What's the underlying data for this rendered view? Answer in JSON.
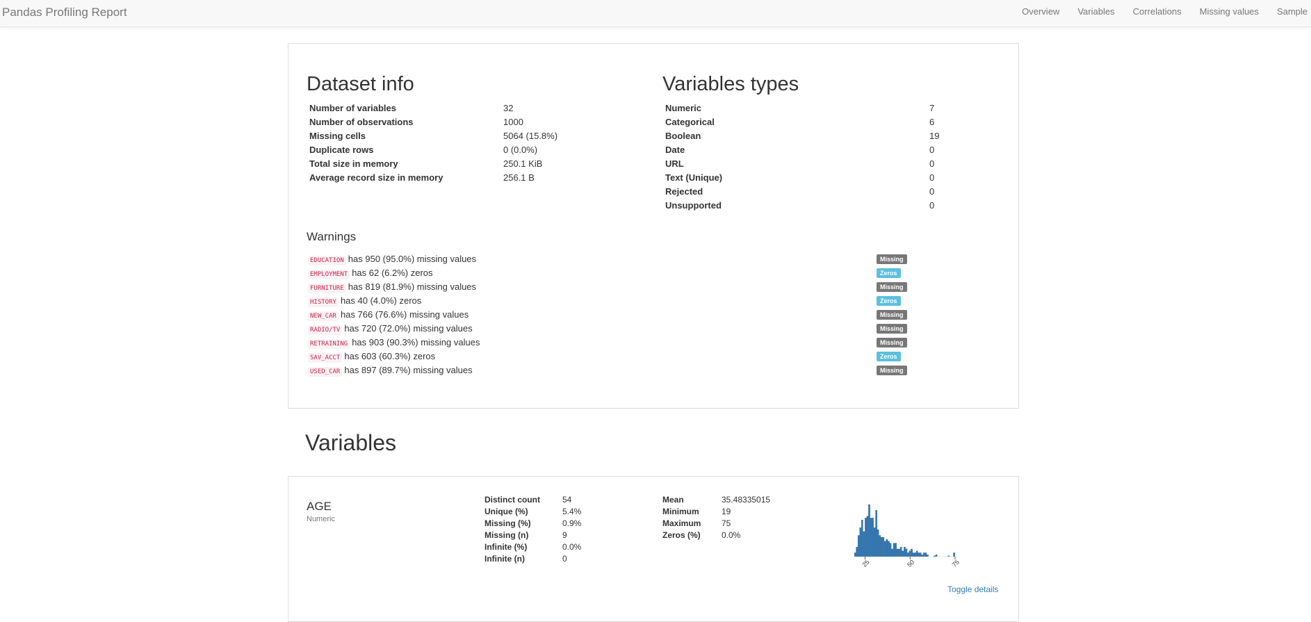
{
  "navbar": {
    "brand": "Pandas Profiling Report",
    "links": [
      "Overview",
      "Variables",
      "Correlations",
      "Missing values",
      "Sample"
    ]
  },
  "dataset_info": {
    "title": "Dataset info",
    "rows": [
      {
        "label": "Number of variables",
        "value": "32"
      },
      {
        "label": "Number of observations",
        "value": "1000"
      },
      {
        "label": "Missing cells",
        "value": "5064 (15.8%)"
      },
      {
        "label": "Duplicate rows",
        "value": "0 (0.0%)"
      },
      {
        "label": "Total size in memory",
        "value": "250.1 KiB"
      },
      {
        "label": "Average record size in memory",
        "value": "256.1 B"
      }
    ]
  },
  "variable_types": {
    "title": "Variables types",
    "rows": [
      {
        "label": "Numeric",
        "value": "7"
      },
      {
        "label": "Categorical",
        "value": "6"
      },
      {
        "label": "Boolean",
        "value": "19"
      },
      {
        "label": "Date",
        "value": "0"
      },
      {
        "label": "URL",
        "value": "0"
      },
      {
        "label": "Text (Unique)",
        "value": "0"
      },
      {
        "label": "Rejected",
        "value": "0"
      },
      {
        "label": "Unsupported",
        "value": "0"
      }
    ]
  },
  "warnings": {
    "title": "Warnings",
    "items": [
      {
        "var": "EDUCATION",
        "text": "has 950 (95.0%) missing values",
        "badge": "Missing",
        "kind": "missing"
      },
      {
        "var": "EMPLOYMENT",
        "text": "has 62 (6.2%) zeros",
        "badge": "Zeros",
        "kind": "zeros"
      },
      {
        "var": "FURNITURE",
        "text": "has 819 (81.9%) missing values",
        "badge": "Missing",
        "kind": "missing"
      },
      {
        "var": "HISTORY",
        "text": "has 40 (4.0%) zeros",
        "badge": "Zeros",
        "kind": "zeros"
      },
      {
        "var": "NEW_CAR",
        "text": "has 766 (76.6%) missing values",
        "badge": "Missing",
        "kind": "missing"
      },
      {
        "var": "RADIO/TV",
        "text": "has 720 (72.0%) missing values",
        "badge": "Missing",
        "kind": "missing"
      },
      {
        "var": "RETRAINING",
        "text": "has 903 (90.3%) missing values",
        "badge": "Missing",
        "kind": "missing"
      },
      {
        "var": "SAV_ACCT",
        "text": "has 603 (60.3%) zeros",
        "badge": "Zeros",
        "kind": "zeros"
      },
      {
        "var": "USED_CAR",
        "text": "has 897 (89.7%) missing values",
        "badge": "Missing",
        "kind": "missing"
      }
    ]
  },
  "variables_section": {
    "title": "Variables",
    "age": {
      "name": "AGE",
      "type": "Numeric",
      "stats_left": [
        {
          "label": "Distinct count",
          "value": "54"
        },
        {
          "label": "Unique (%)",
          "value": "5.4%"
        },
        {
          "label": "Missing (%)",
          "value": "0.9%"
        },
        {
          "label": "Missing (n)",
          "value": "9"
        },
        {
          "label": "Infinite (%)",
          "value": "0.0%"
        },
        {
          "label": "Infinite (n)",
          "value": "0"
        }
      ],
      "stats_right": [
        {
          "label": "Mean",
          "value": "35.48335015"
        },
        {
          "label": "Minimum",
          "value": "19"
        },
        {
          "label": "Maximum",
          "value": "75"
        },
        {
          "label": "Zeros (%)",
          "value": "0.0%"
        }
      ],
      "toggle_label": "Toggle details",
      "histogram": {
        "type": "bar",
        "x_ticks": [
          "25",
          "50",
          "75"
        ],
        "xlim": [
          19,
          75
        ],
        "bin_start": 19,
        "bin_width": 1,
        "counts": [
          4,
          10,
          22,
          30,
          38,
          26,
          40,
          42,
          54,
          40,
          40,
          30,
          48,
          28,
          22,
          20,
          20,
          16,
          18,
          16,
          14,
          8,
          14,
          14,
          8,
          8,
          10,
          6,
          10,
          8,
          4,
          6,
          8,
          4,
          4,
          6,
          4,
          4,
          2,
          4,
          4,
          2,
          0,
          0,
          0,
          1,
          2,
          0,
          0,
          0,
          0,
          0,
          0,
          1,
          0,
          0,
          4
        ],
        "bar_color": "#337ab7"
      }
    }
  }
}
